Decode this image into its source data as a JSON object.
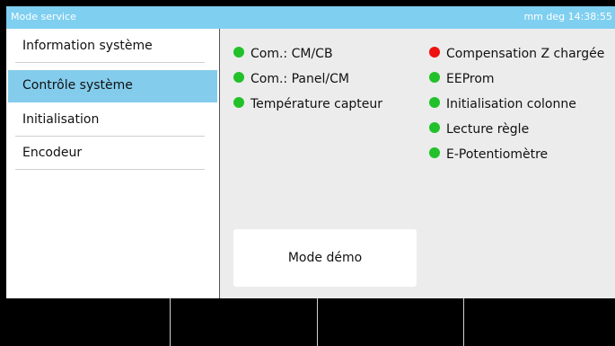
{
  "titlebar": {
    "title": "Mode service",
    "status": "mm  deg  14:38:55"
  },
  "sidebar": {
    "items": [
      {
        "label": "Information système"
      },
      {
        "label": "Contrôle système",
        "active": true
      },
      {
        "label": "Initialisation"
      },
      {
        "label": "Encodeur"
      }
    ]
  },
  "status_colors": {
    "ok": "#22c12a",
    "error": "#ee1111"
  },
  "checks": {
    "left": [
      {
        "label": "Com.: CM/CB",
        "state": "ok"
      },
      {
        "label": "Com.: Panel/CM",
        "state": "ok"
      },
      {
        "label": "Température capteur",
        "state": "ok"
      }
    ],
    "right": [
      {
        "label": "Compensation Z chargée",
        "state": "error"
      },
      {
        "label": "EEProm",
        "state": "ok"
      },
      {
        "label": "Initialisation colonne",
        "state": "ok"
      },
      {
        "label": "Lecture règle",
        "state": "ok"
      },
      {
        "label": "E-Potentiomètre",
        "state": "ok"
      }
    ]
  },
  "demo_button": {
    "label": "Mode démo"
  }
}
